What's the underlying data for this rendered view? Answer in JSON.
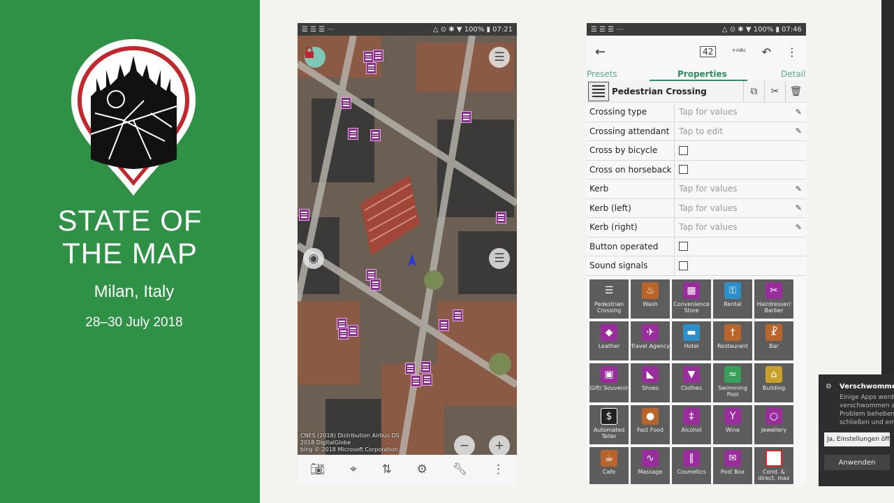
{
  "brand": {
    "title_line1": "STATE OF",
    "title_line2": "THE MAP",
    "place": "Milan, Italy",
    "dates": "28–30 July 2018",
    "green": "#2e9146"
  },
  "phone_map": {
    "status_left": "☰ ☰ ☰ ⋯",
    "status_right": "△ ⊙ ✱ ▼ 100% ▮ 07:21",
    "attribution_line1": "CNES (2018) Distribution Airbus DS",
    "attribution_line2": "2018 DigitalGlobe",
    "attribution_line3": "bing © 2018 Microsoft Corporation",
    "zoom_out": "−",
    "zoom_in": "+",
    "bottom_icons": [
      "camera-icon",
      "gps-icon",
      "transfer-icon",
      "preferences-icon",
      "tools-icon",
      "overflow-menu-icon"
    ]
  },
  "phone_editor": {
    "status_right": "△ ⊙ ✱ ▼ 100% ▮ 07:46",
    "count_badge": "42",
    "tabs": {
      "presets": "Presets",
      "properties": "Properties",
      "details": "Details"
    },
    "preset_name": "Pedestrian Crossing",
    "rows": [
      {
        "key": "Crossing type",
        "value": "Tap for values",
        "kind": "text"
      },
      {
        "key": "Crossing attendant",
        "value": "Tap to edit",
        "kind": "text"
      },
      {
        "key": "Cross by bicycle",
        "value": "",
        "kind": "check"
      },
      {
        "key": "Cross on horseback",
        "value": "",
        "kind": "check"
      },
      {
        "key": "Kerb",
        "value": "Tap for values",
        "kind": "text"
      },
      {
        "key": "Kerb (left)",
        "value": "Tap for values",
        "kind": "text"
      },
      {
        "key": "Kerb (right)",
        "value": "Tap for values",
        "kind": "text"
      },
      {
        "key": "Button operated",
        "value": "",
        "kind": "check"
      },
      {
        "key": "Sound signals",
        "value": "",
        "kind": "check"
      }
    ],
    "presets": [
      {
        "label": "Pedestrian Crossing",
        "glyph": "☰",
        "color": "c-white"
      },
      {
        "label": "Wash",
        "glyph": "♨",
        "color": "c-brown"
      },
      {
        "label": "Convenience Store",
        "glyph": "▦",
        "color": "c-mag"
      },
      {
        "label": "Rental",
        "glyph": "⚿",
        "color": "c-blue"
      },
      {
        "label": "Hairdresser/ Barber",
        "glyph": "✂",
        "color": "c-mag"
      },
      {
        "label": "Leather",
        "glyph": "◆",
        "color": "c-mag"
      },
      {
        "label": "Travel Agency",
        "glyph": "✈",
        "color": "c-mag"
      },
      {
        "label": "Hotel",
        "glyph": "▬",
        "color": "c-blue"
      },
      {
        "label": "Restaurant",
        "glyph": "†",
        "color": "c-brown"
      },
      {
        "label": "Bar",
        "glyph": "☧",
        "color": "c-brown"
      },
      {
        "label": "Gift/ Souvenir",
        "glyph": "▣",
        "color": "c-mag"
      },
      {
        "label": "Shoes",
        "glyph": "◣",
        "color": "c-mag"
      },
      {
        "label": "Clothes",
        "glyph": "▼",
        "color": "c-mag"
      },
      {
        "label": "Swimming Pool",
        "glyph": "≈",
        "color": "c-green"
      },
      {
        "label": "Building",
        "glyph": "⌂",
        "color": "c-yel"
      },
      {
        "label": "Automated Teller",
        "glyph": "$",
        "color": "c-blk"
      },
      {
        "label": "Fast Food",
        "glyph": "●",
        "color": "c-brown"
      },
      {
        "label": "Alcohol",
        "glyph": "‡",
        "color": "c-mag"
      },
      {
        "label": "Wine",
        "glyph": "Y",
        "color": "c-mag"
      },
      {
        "label": "Jewellery",
        "glyph": "○",
        "color": "c-mag"
      },
      {
        "label": "Cafe",
        "glyph": "☕",
        "color": "c-brown"
      },
      {
        "label": "Massage",
        "glyph": "∿",
        "color": "c-mag"
      },
      {
        "label": "Cosmetics",
        "glyph": "‖",
        "color": "c-mag"
      },
      {
        "label": "Post Box",
        "glyph": "✉",
        "color": "c-mag"
      },
      {
        "label": "Cond. & direct. max",
        "glyph": "60",
        "color": "c-red"
      }
    ]
  },
  "notification": {
    "title": "Verschwommen a",
    "body_line1": "Einige Apps werd",
    "body_line2": "verschwommen a",
    "body_line3": "Problem beheben",
    "body_line4": "schließen und ern",
    "select_value": "Ja, Einstellungen öffn",
    "apply_label": "Anwenden"
  }
}
